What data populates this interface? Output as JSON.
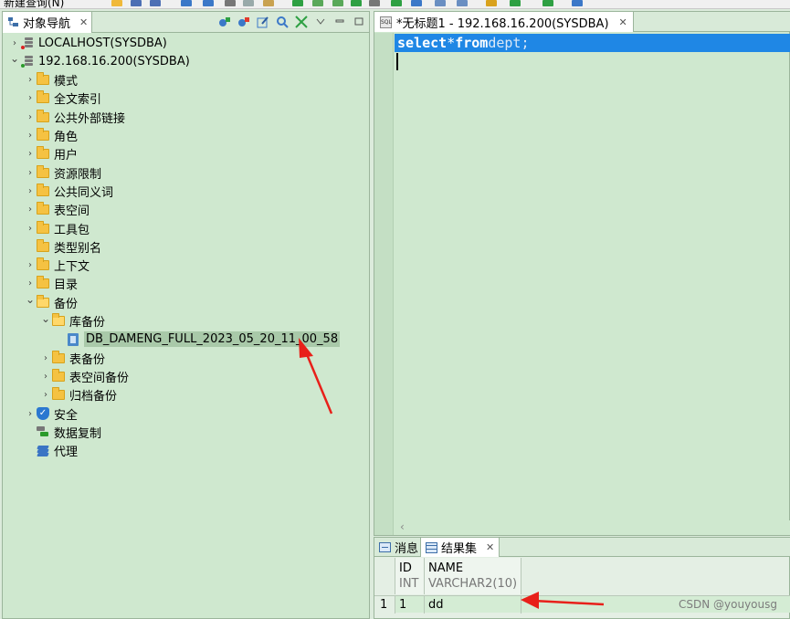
{
  "toolbar": {
    "new_query_label": "新建查询(N)"
  },
  "object_nav": {
    "tab_label": "对象导航",
    "tree": [
      {
        "label": "LOCALHOST(SYSDBA)",
        "level": 0,
        "expanded": false,
        "icon": "server-icon"
      },
      {
        "label": "192.168.16.200(SYSDBA)",
        "level": 0,
        "expanded": true,
        "icon": "server-icon"
      },
      {
        "label": "模式",
        "level": 1,
        "expanded": false,
        "icon": "folder-icon"
      },
      {
        "label": "全文索引",
        "level": 1,
        "expanded": false,
        "icon": "folder-icon"
      },
      {
        "label": "公共外部链接",
        "level": 1,
        "expanded": false,
        "icon": "folder-icon"
      },
      {
        "label": "角色",
        "level": 1,
        "expanded": false,
        "icon": "folder-icon"
      },
      {
        "label": "用户",
        "level": 1,
        "expanded": false,
        "icon": "folder-icon"
      },
      {
        "label": "资源限制",
        "level": 1,
        "expanded": false,
        "icon": "folder-icon"
      },
      {
        "label": "公共同义词",
        "level": 1,
        "expanded": false,
        "icon": "folder-icon"
      },
      {
        "label": "表空间",
        "level": 1,
        "expanded": false,
        "icon": "folder-icon"
      },
      {
        "label": "工具包",
        "level": 1,
        "expanded": false,
        "icon": "folder-icon"
      },
      {
        "label": "类型别名",
        "level": 1,
        "expanded": null,
        "icon": "folder-icon"
      },
      {
        "label": "上下文",
        "level": 1,
        "expanded": false,
        "icon": "folder-icon"
      },
      {
        "label": "目录",
        "level": 1,
        "expanded": false,
        "icon": "folder-icon"
      },
      {
        "label": "备份",
        "level": 1,
        "expanded": true,
        "icon": "folder-open-icon"
      },
      {
        "label": "库备份",
        "level": 2,
        "expanded": true,
        "icon": "folder-open-icon"
      },
      {
        "label": "DB_DAMENG_FULL_2023_05_20_11_00_58",
        "level": 3,
        "expanded": null,
        "icon": "backup-file-icon",
        "selected": true
      },
      {
        "label": "表备份",
        "level": 2,
        "expanded": false,
        "icon": "folder-icon"
      },
      {
        "label": "表空间备份",
        "level": 2,
        "expanded": false,
        "icon": "folder-icon"
      },
      {
        "label": "归档备份",
        "level": 2,
        "expanded": false,
        "icon": "folder-icon"
      },
      {
        "label": "安全",
        "level": 1,
        "expanded": false,
        "icon": "shield-icon"
      },
      {
        "label": "数据复制",
        "level": 1,
        "expanded": null,
        "icon": "replication-icon"
      },
      {
        "label": "代理",
        "level": 1,
        "expanded": null,
        "icon": "agent-icon"
      }
    ]
  },
  "editor": {
    "tab_label": "*无标题1 - 192.168.16.200(SYSDBA)",
    "sql": {
      "kw1": "select",
      "star": "*",
      "kw2": "from",
      "ident": "dept;"
    }
  },
  "results": {
    "tabs": {
      "messages": "消息",
      "result_set": "结果集"
    },
    "columns": [
      {
        "name": "ID",
        "type": "INT"
      },
      {
        "name": "NAME",
        "type": "VARCHAR2(10)"
      }
    ],
    "rows": [
      {
        "num": "1",
        "cells": [
          "1",
          "dd"
        ]
      }
    ]
  },
  "watermark": "CSDN @youyousg",
  "colors": {
    "selection_blue": "#1f87e5",
    "panel_green": "#cfe8cf",
    "arrow_red": "#e8201a"
  }
}
